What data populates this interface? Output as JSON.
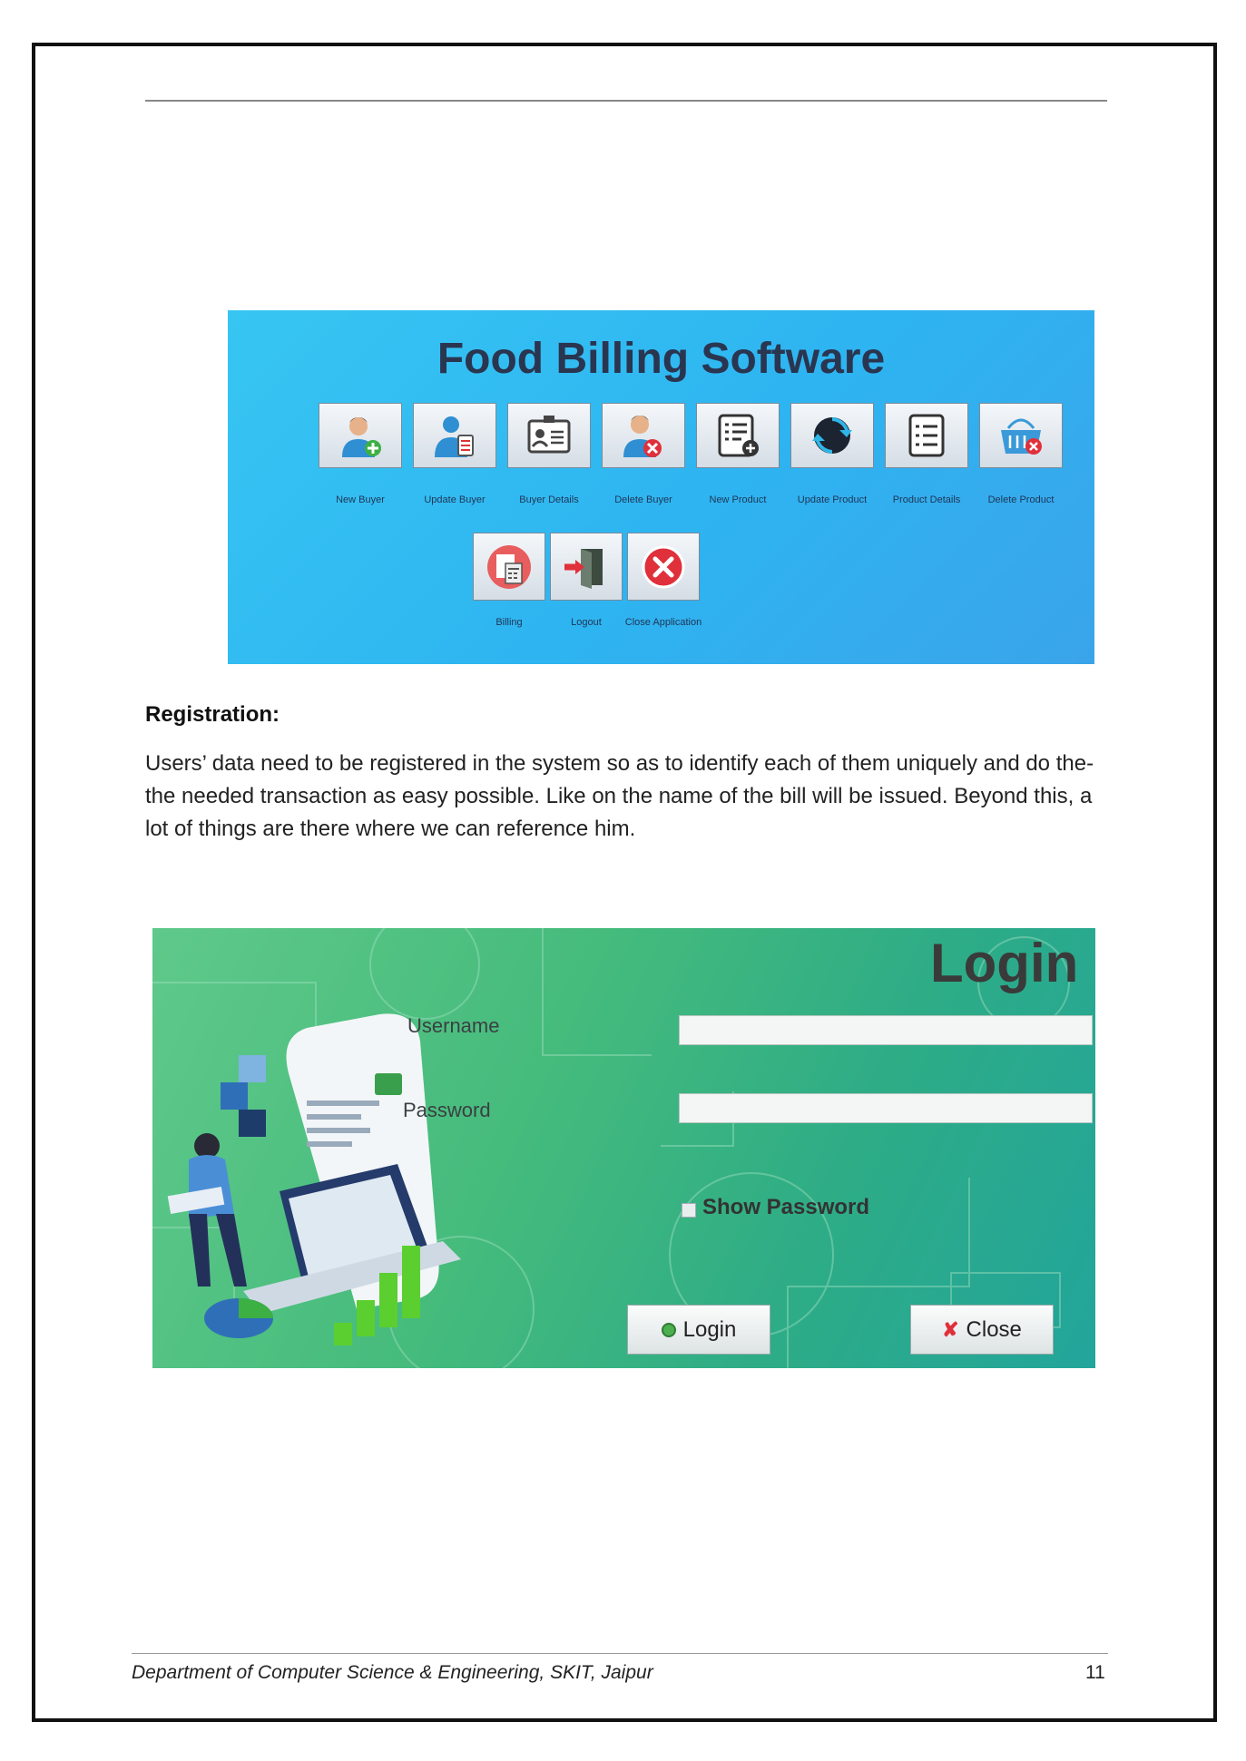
{
  "dashboard": {
    "title": "Food Billing Software",
    "row1": [
      {
        "label": "New Buyer",
        "icon": "add-user-icon"
      },
      {
        "label": "Update Buyer",
        "icon": "edit-user-icon"
      },
      {
        "label": "Buyer Details",
        "icon": "id-card-icon"
      },
      {
        "label": "Delete Buyer",
        "icon": "remove-user-icon"
      },
      {
        "label": "New Product",
        "icon": "add-list-icon"
      },
      {
        "label": "Update Product",
        "icon": "sync-icon"
      },
      {
        "label": "Product Details",
        "icon": "list-icon"
      },
      {
        "label": "Delete Product",
        "icon": "delete-basket-icon"
      }
    ],
    "row2": [
      {
        "label": "Billing",
        "icon": "calculator-icon"
      },
      {
        "label": "Logout",
        "icon": "logout-door-icon"
      },
      {
        "label": "Close Application",
        "icon": "close-circle-icon"
      }
    ]
  },
  "section": {
    "heading": "Registration:",
    "paragraph": "Users’ data need to be registered in the system so as to identify each of them uniquely and do the-the needed transaction as easy possible. Like on the name of the bill will be issued. Beyond this, a lot of things are there where we can reference him."
  },
  "login": {
    "title": "Login",
    "username_label": "Username",
    "username_value": "",
    "password_label": "Password",
    "password_value": "",
    "show_password_label": "Show Password",
    "login_button": "Login",
    "close_button": "Close"
  },
  "footer": {
    "text": "Department of Computer Science & Engineering, SKIT, Jaipur",
    "page_number": "11"
  }
}
